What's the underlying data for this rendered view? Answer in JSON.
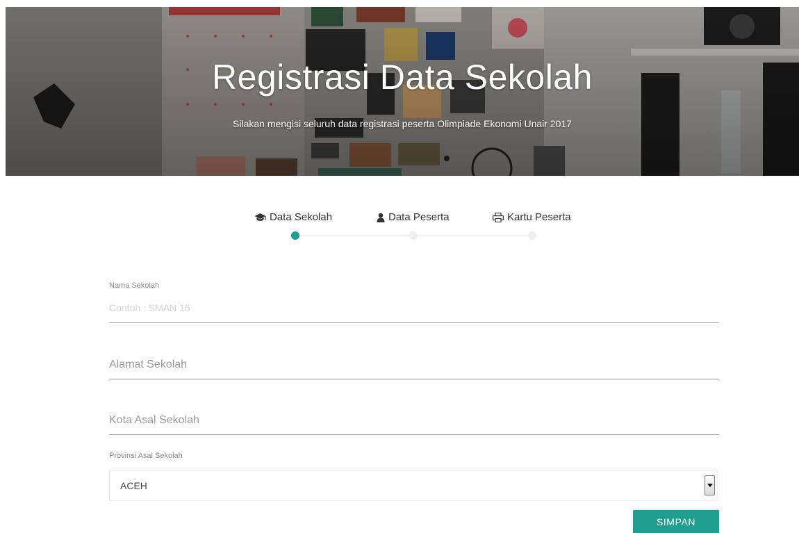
{
  "hero": {
    "title": "Registrasi Data Sekolah",
    "subtitle": "Silakan mengisi seluruh data registrasi peserta Olimpiade Ekonomi Unair 2017"
  },
  "stepper": {
    "steps": [
      {
        "label": "Data Sekolah",
        "icon": "graduation-cap-icon",
        "active": true
      },
      {
        "label": "Data Peserta",
        "icon": "user-icon",
        "active": false
      },
      {
        "label": "Kartu Peserta",
        "icon": "print-icon",
        "active": false
      }
    ],
    "active_color": "#1e9e8f"
  },
  "form": {
    "nama_sekolah": {
      "label": "Nama Sekolah",
      "placeholder": "Contoh : SMAN 15",
      "value": ""
    },
    "alamat_sekolah": {
      "placeholder": "Alamat Sekolah",
      "value": ""
    },
    "kota_asal": {
      "placeholder": "Kota Asal Sekolah",
      "value": ""
    },
    "provinsi": {
      "label": "Provinsi Asal Sekolah",
      "selected": "ACEH"
    },
    "submit_label": "SIMPAN"
  },
  "colors": {
    "accent": "#1e9e8f",
    "input_border": "#9a9a9a"
  }
}
